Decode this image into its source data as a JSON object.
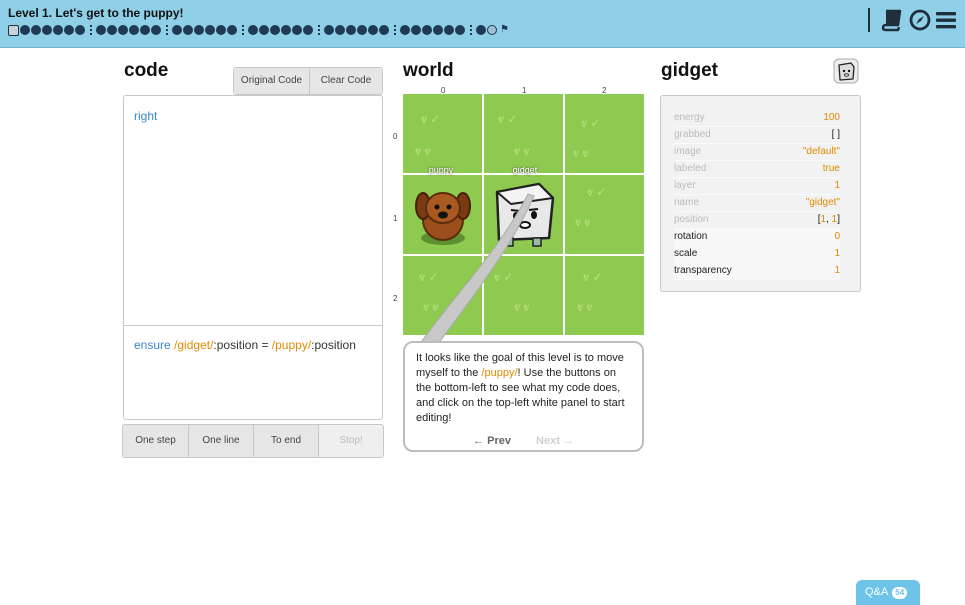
{
  "header": {
    "level_title": "Level 1. Let's get to the puppy!",
    "icons": [
      "book-icon",
      "compass-icon",
      "menu-icon"
    ]
  },
  "code": {
    "heading": "code",
    "buttons": {
      "original": "Original Code",
      "clear": "Clear Code"
    },
    "line": "right",
    "ensure": {
      "keyword": "ensure",
      "left": "/gidget/",
      "left_prop": ":position = ",
      "right": "/puppy/",
      "right_prop": ":position"
    },
    "controls": {
      "one_step": "One step",
      "one_line": "One line",
      "to_end": "To end",
      "stop": "Stop!"
    }
  },
  "world": {
    "heading": "world",
    "cols": [
      "0",
      "1",
      "2"
    ],
    "rows": [
      "0",
      "1",
      "2"
    ],
    "puppy_label": "puppy",
    "gidget_label": "gidget",
    "bubble": {
      "text_before": "It looks like the goal of this level is to move myself to the ",
      "highlight": "/puppy/",
      "text_after": "! Use the buttons on the bottom-left to see what my code does, and click on the top-left white panel to start editing!",
      "prev": "← Prev",
      "next": "Next →"
    }
  },
  "gidget": {
    "heading": "gidget",
    "props": [
      {
        "name": "energy",
        "value": "100"
      },
      {
        "name": "grabbed",
        "value": "[ ]"
      },
      {
        "name": "image",
        "value": "\"default\""
      },
      {
        "name": "labeled",
        "value": "true"
      },
      {
        "name": "layer",
        "value": "1"
      },
      {
        "name": "name",
        "value": "\"gidget\""
      },
      {
        "name": "position",
        "value_open": "[",
        "value_x": "1",
        "value_sep": ", ",
        "value_y": "1",
        "value_close": "]"
      },
      {
        "name": "rotation",
        "value": "0"
      },
      {
        "name": "scale",
        "value": "1"
      },
      {
        "name": "transparency",
        "value": "1"
      }
    ]
  },
  "qa": {
    "label": "Q&A",
    "count": "54"
  },
  "colors": {
    "topbar": "#8fcfe8",
    "grass": "#8ec950",
    "orange": "#e08a00",
    "blue": "#3a86c8"
  }
}
